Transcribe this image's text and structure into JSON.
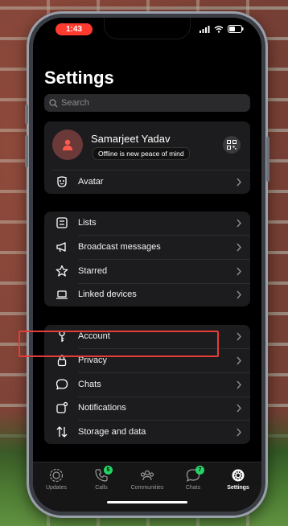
{
  "status_bar": {
    "time": "1:43"
  },
  "title": "Settings",
  "search": {
    "placeholder": "Search"
  },
  "profile": {
    "name": "Samarjeet Yadav",
    "status": "Offline is new peace of mind",
    "icons": {
      "avatar": "person-icon",
      "qr": "qr-code-icon"
    }
  },
  "avatar_row": {
    "label": "Avatar",
    "icon": "avatar-face-icon"
  },
  "group_lists": [
    {
      "label": "Lists",
      "icon": "list-icon"
    },
    {
      "label": "Broadcast messages",
      "icon": "megaphone-icon"
    },
    {
      "label": "Starred",
      "icon": "star-icon"
    },
    {
      "label": "Linked devices",
      "icon": "laptop-icon"
    }
  ],
  "group_settings": [
    {
      "label": "Account",
      "icon": "key-icon"
    },
    {
      "label": "Privacy",
      "icon": "lock-icon"
    },
    {
      "label": "Chats",
      "icon": "chat-bubble-icon"
    },
    {
      "label": "Notifications",
      "icon": "notification-icon"
    },
    {
      "label": "Storage and data",
      "icon": "arrows-updown-icon"
    }
  ],
  "tabs": [
    {
      "label": "Updates",
      "icon": "updates-icon",
      "badge": ""
    },
    {
      "label": "Calls",
      "icon": "phone-icon",
      "badge": "5"
    },
    {
      "label": "Communities",
      "icon": "communities-icon",
      "badge": ""
    },
    {
      "label": "Chats",
      "icon": "chats-icon",
      "badge": "7"
    },
    {
      "label": "Settings",
      "icon": "settings-gear-icon",
      "badge": ""
    }
  ],
  "colors": {
    "accent": "#25d366",
    "highlight": "#e53e3a",
    "status_pill": "#ff3b30"
  }
}
